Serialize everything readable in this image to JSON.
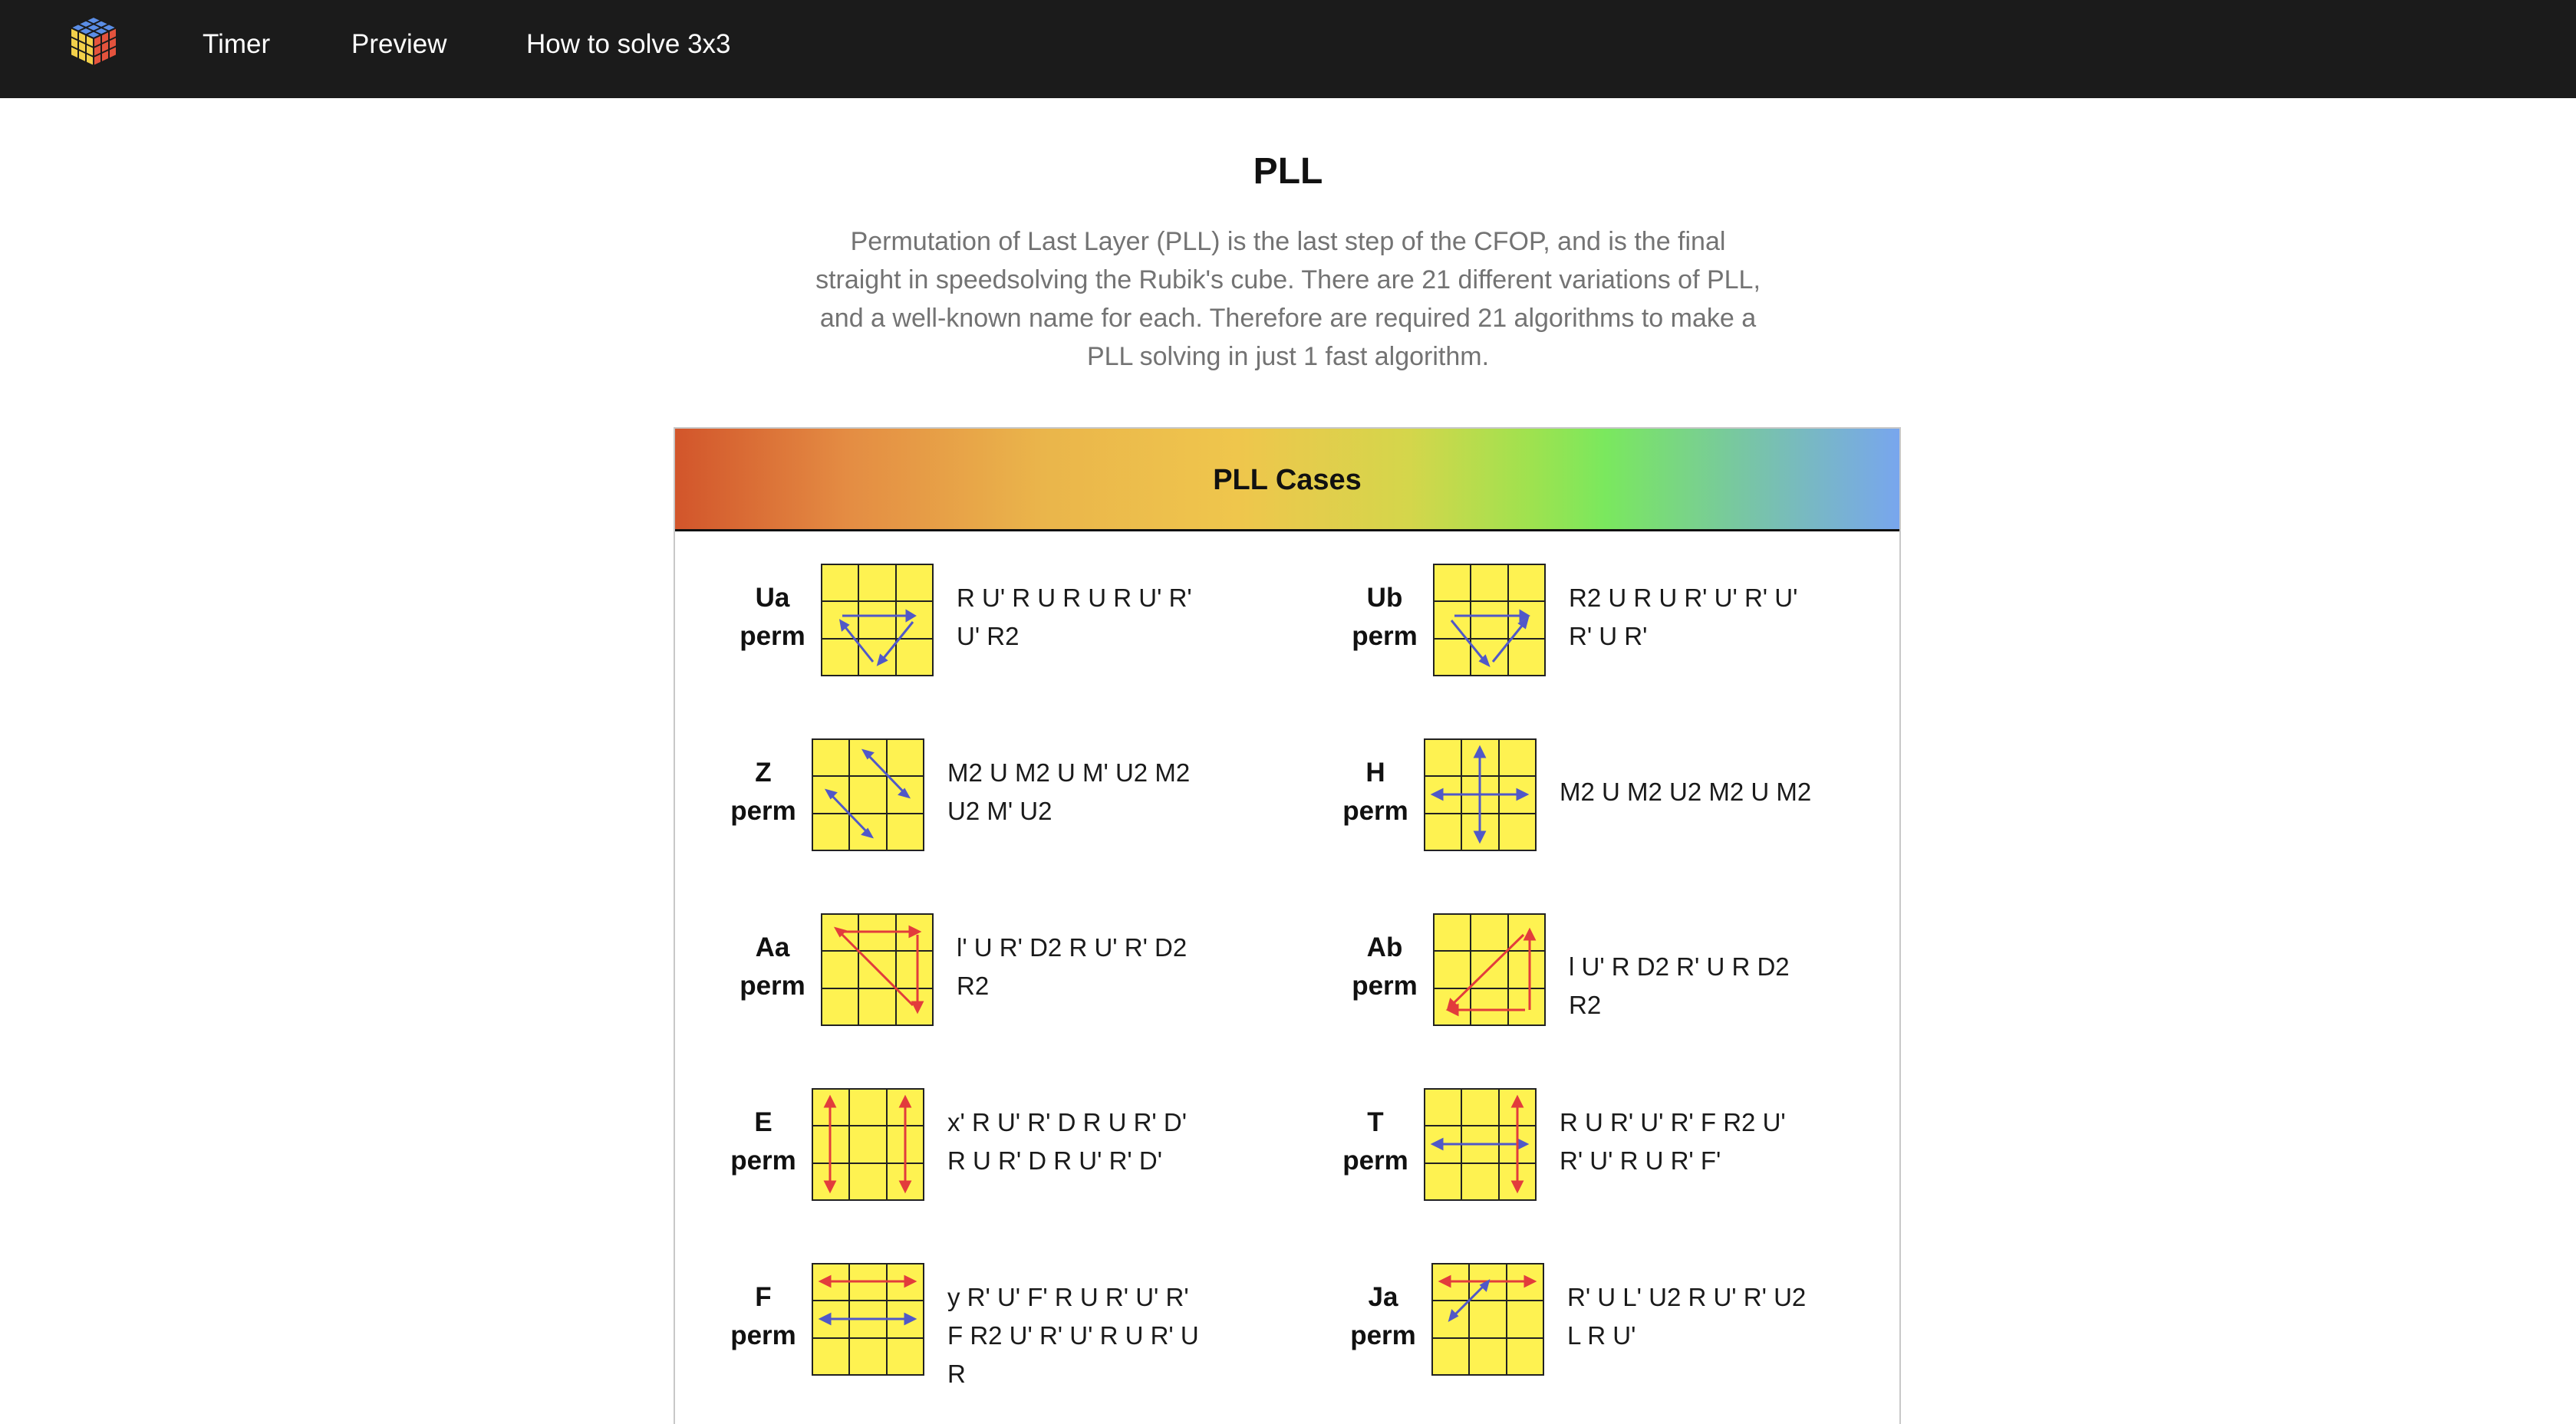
{
  "nav": {
    "logo_icon": "rubiks-cube-icon",
    "links": [
      "Timer",
      "Preview",
      "How to solve 3x3"
    ]
  },
  "page": {
    "title": "PLL",
    "intro": "Permutation of Last Layer (PLL) is the last step of the CFOP, and is the final straight in speedsolving the Rubik's cube. There are 21 different variations of PLL, and a well-known name for each. Therefore are required 21 algorithms to make a PLL solving in just 1 fast algorithm."
  },
  "card": {
    "title": "PLL Cases",
    "gradient_colors": [
      "#d2552b",
      "#e48c43",
      "#eab54b",
      "#efc64c",
      "#9ee24f",
      "#78a6ee"
    ]
  },
  "colors": {
    "sticker": "#fef251",
    "blue_arrow": "#5058c8",
    "red_arrow": "#e23c3c",
    "nav_bg": "#1b1b1b"
  },
  "cases": [
    {
      "name_line1": "Ua",
      "name_line2": "perm",
      "alg": "R U' R U R U R U' R' U' R2",
      "icon": "ua-perm-diagram"
    },
    {
      "name_line1": "Ub",
      "name_line2": "perm",
      "alg": "R2 U R U R' U' R' U' R' U R'",
      "icon": "ub-perm-diagram"
    },
    {
      "name_line1": "Z",
      "name_line2": "perm",
      "alg": "M2 U M2 U M' U2 M2 U2 M' U2",
      "icon": "z-perm-diagram"
    },
    {
      "name_line1": "H",
      "name_line2": "perm",
      "alg": "M2 U M2 U2 M2 U M2",
      "icon": "h-perm-diagram"
    },
    {
      "name_line1": "Aa",
      "name_line2": "perm",
      "alg": "l' U R' D2 R U' R' D2 R2",
      "icon": "aa-perm-diagram"
    },
    {
      "name_line1": "Ab",
      "name_line2": "perm",
      "alg": "l U' R D2 R' U R D2 R2",
      "icon": "ab-perm-diagram"
    },
    {
      "name_line1": "E",
      "name_line2": "perm",
      "alg": "x' R U' R' D R U R' D' R U R' D R U' R' D'",
      "icon": "e-perm-diagram"
    },
    {
      "name_line1": "T",
      "name_line2": "perm",
      "alg": "R U R' U' R' F R2 U' R' U' R U R' F'",
      "icon": "t-perm-diagram"
    },
    {
      "name_line1": "F",
      "name_line2": "perm",
      "alg": "y R' U' F' R U R' U' R' F R2 U' R' U' R U R' U R",
      "icon": "f-perm-diagram"
    },
    {
      "name_line1": "Ja",
      "name_line2": "perm",
      "alg": "R' U L' U2 R U' R' U2 L R U'",
      "icon": "ja-perm-diagram"
    }
  ]
}
